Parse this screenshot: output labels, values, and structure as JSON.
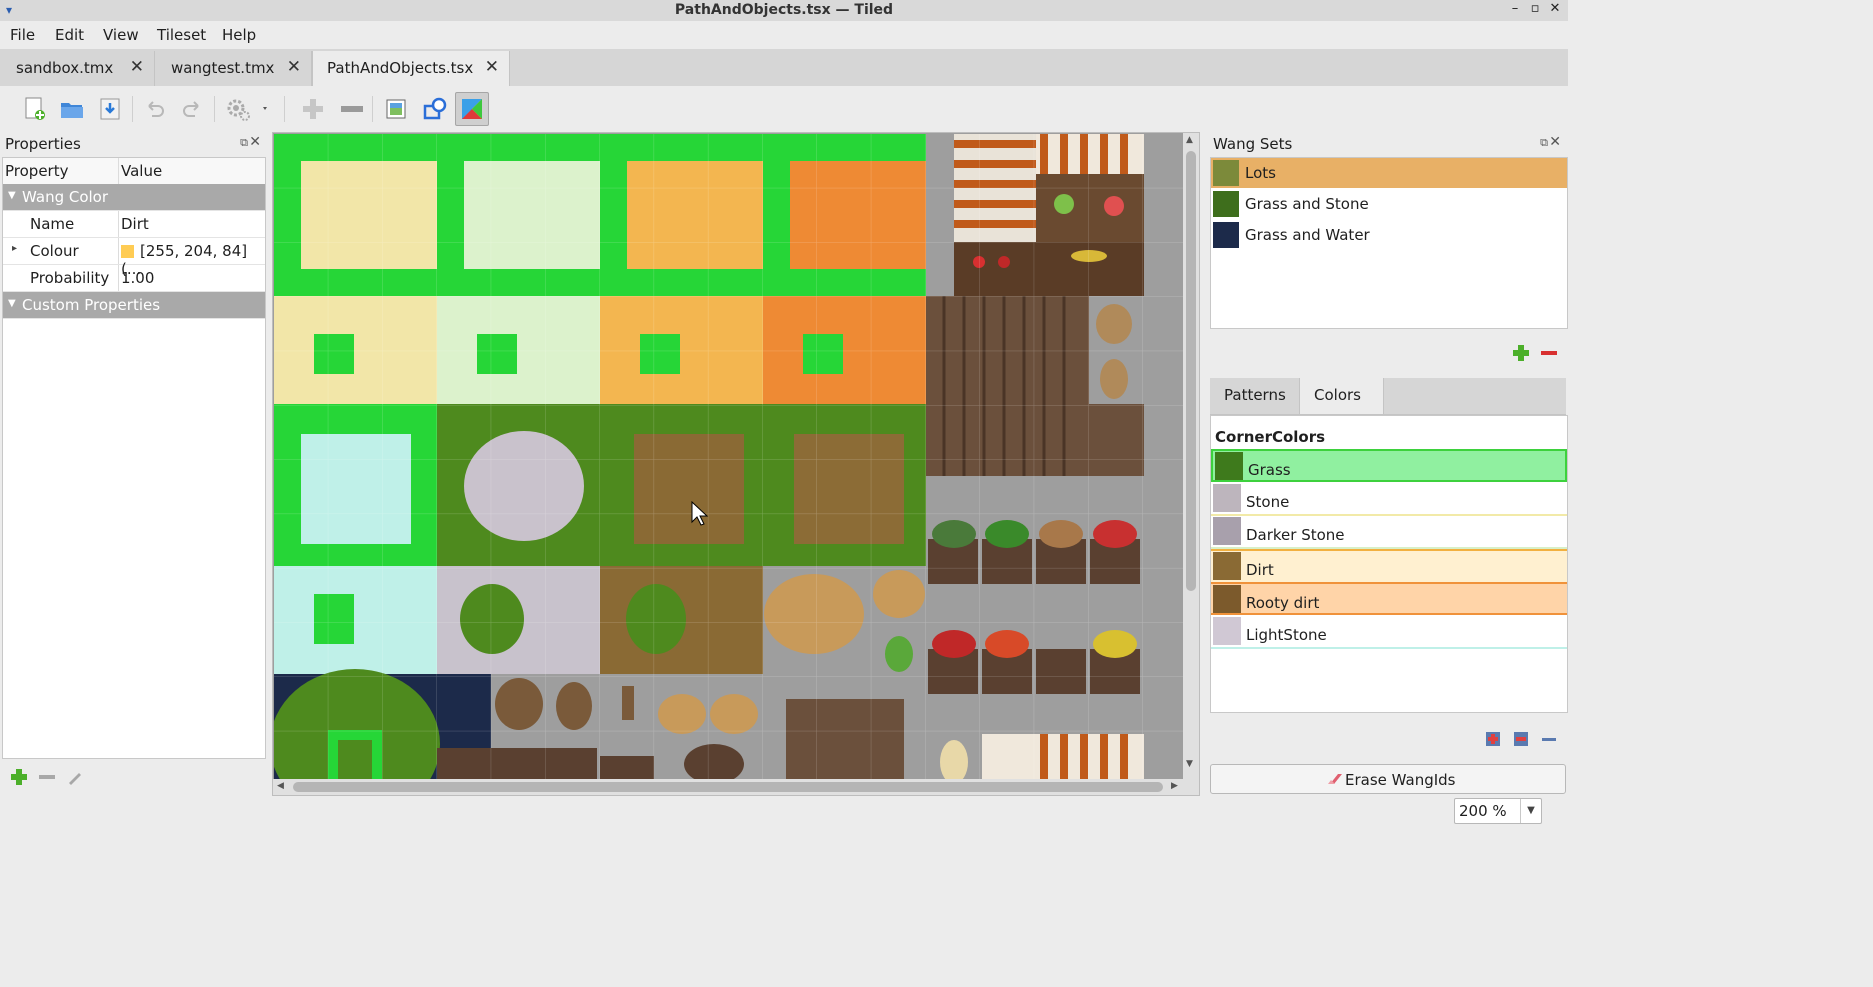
{
  "window": {
    "title": "PathAndObjects.tsx — Tiled"
  },
  "menu": [
    "File",
    "Edit",
    "View",
    "Tileset",
    "Help"
  ],
  "tabs": [
    {
      "label": "sandbox.tmx"
    },
    {
      "label": "wangtest.tmx"
    },
    {
      "label": "PathAndObjects.tsx"
    }
  ],
  "toolbar": {
    "icons": [
      "new-tileset-icon",
      "open-icon",
      "save-icon",
      "undo-icon",
      "redo-icon",
      "tileset-properties-icon",
      "add-tiles-icon",
      "remove-tiles-icon",
      "edit-image-icon",
      "collision-editor-icon",
      "wang-sets-icon"
    ]
  },
  "properties": {
    "title": "Properties",
    "col_property": "Property",
    "col_value": "Value",
    "group_wang_color": "Wang Color",
    "rows": [
      {
        "key": "Name",
        "value": "Dirt"
      },
      {
        "key": "Colour",
        "value": "[255, 204, 84] (..."
      },
      {
        "key": "Probability",
        "value": "1.00"
      }
    ],
    "group_custom": "Custom Properties"
  },
  "wangsets": {
    "title": "Wang Sets",
    "items": [
      {
        "label": "Lots",
        "selected": true
      },
      {
        "label": "Grass and Stone",
        "selected": false
      },
      {
        "label": "Grass and Water",
        "selected": false
      }
    ]
  },
  "wang_tabs": [
    {
      "label": "Patterns",
      "active": false
    },
    {
      "label": "Colors",
      "active": true
    }
  ],
  "colors": {
    "header": "CornerColors",
    "items": [
      {
        "label": "Grass",
        "color": "#90f0a0",
        "border": "#3dd13d"
      },
      {
        "label": "Stone",
        "color": "#ffffff",
        "border": "#f2eaa8"
      },
      {
        "label": "Darker Stone",
        "color": "#ffffff",
        "border": "#d8f0c8"
      },
      {
        "label": "Dirt",
        "color": "#fff0d0",
        "border": "#f2b040"
      },
      {
        "label": "Rooty dirt",
        "color": "#ffd4a8",
        "border": "#f0923a"
      },
      {
        "label": "LightStone",
        "color": "#ffffff",
        "border": "#bff0e8"
      }
    ]
  },
  "erase_button": "Erase WangIds",
  "zoom": "200 %"
}
